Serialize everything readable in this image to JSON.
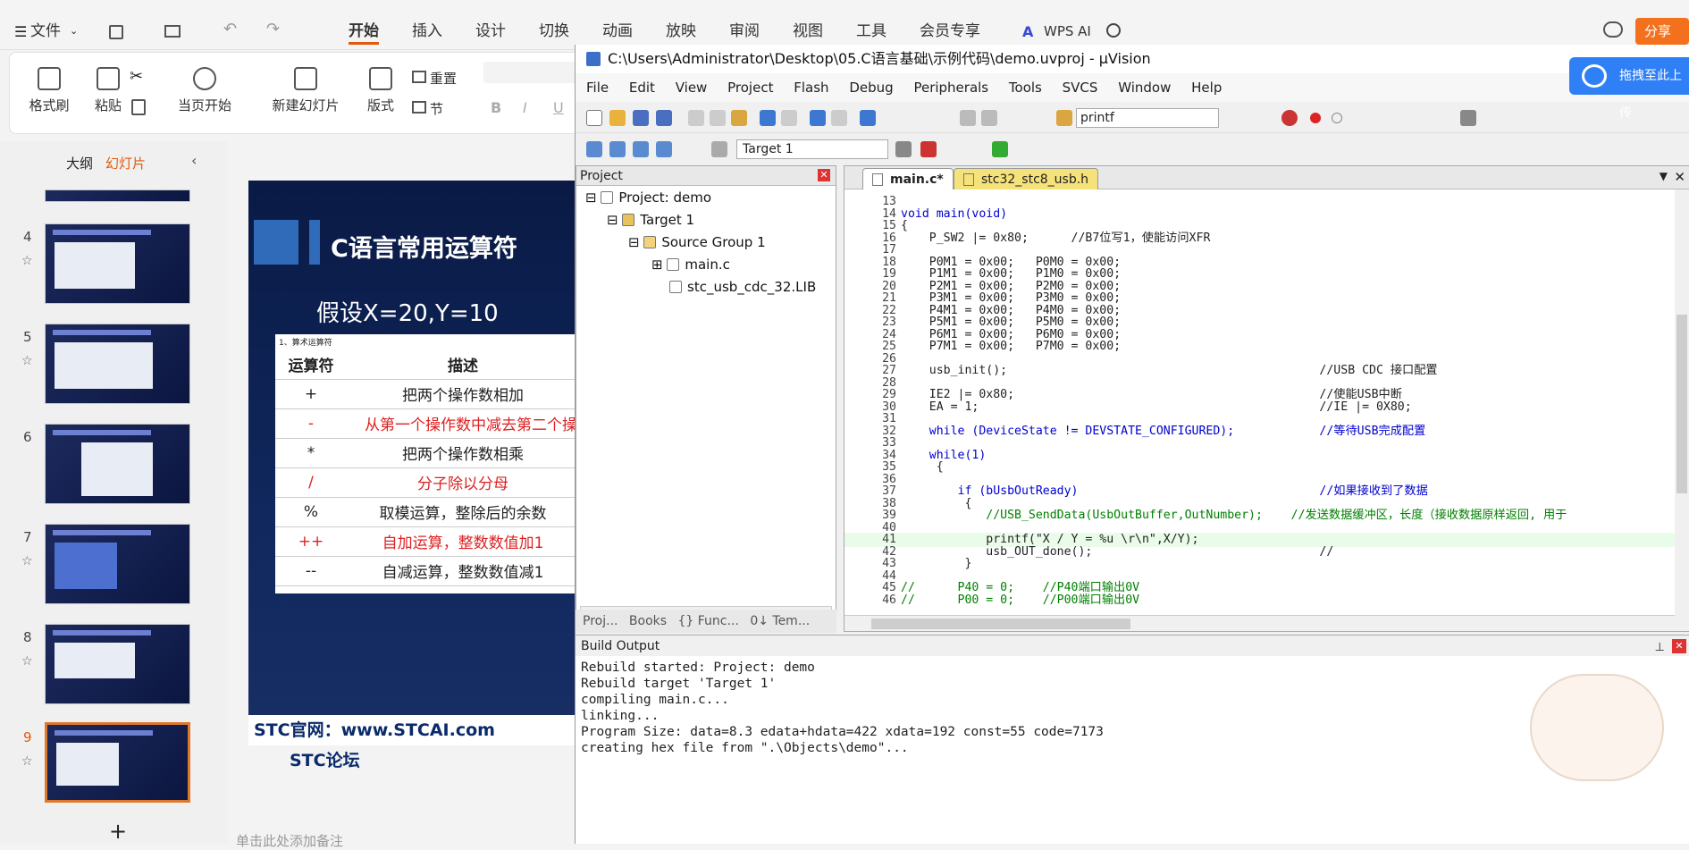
{
  "wps": {
    "file_menu": "文件",
    "tabs": [
      "开始",
      "插入",
      "设计",
      "切换",
      "动画",
      "放映",
      "审阅",
      "视图",
      "工具",
      "会员专享"
    ],
    "ai_label": "WPS AI",
    "share_label": "分享",
    "cloud_label": "拖拽至此上传"
  },
  "ribbon": {
    "format_painter": "格式刷",
    "paste": "粘贴",
    "from_current": "当页开始",
    "new_slide": "新建幻灯片",
    "layout": "版式",
    "section": "节",
    "reset": "重置"
  },
  "slide_panel": {
    "tab_outline": "大纲",
    "tab_slides": "幻灯片",
    "slide_numbers": [
      "4",
      "5",
      "6",
      "7",
      "8",
      "9"
    ],
    "add_label": "+"
  },
  "slide": {
    "title": "C语言常用运算符",
    "subtitle": "假设X=20,Y=10",
    "table_caption": "1、算术运算符",
    "col_op": "运算符",
    "col_desc": "描述",
    "rows": [
      {
        "op": "+",
        "desc": "把两个操作数相加",
        "red": false
      },
      {
        "op": "-",
        "desc": "从第一个操作数中减去第二个操",
        "red": true
      },
      {
        "op": "*",
        "desc": "把两个操作数相乘",
        "red": false
      },
      {
        "op": "/",
        "desc": "分子除以分母",
        "red": true
      },
      {
        "op": "%",
        "desc": "取模运算，整除后的余数",
        "red": false
      },
      {
        "op": "++",
        "desc": "自加运算，整数数值加1",
        "red": true
      },
      {
        "op": "--",
        "desc": "自减运算，整数数值减1",
        "red": false
      }
    ],
    "footer_left": "STC官网：www.STCAI.com",
    "footer_right": "STC论坛",
    "notes_hint": "单击此处添加备注"
  },
  "uvision": {
    "title": "C:\\Users\\Administrator\\Desktop\\05.C语言基础\\示例代码\\demo.uvproj - µVision",
    "menu": [
      "File",
      "Edit",
      "View",
      "Project",
      "Flash",
      "Debug",
      "Peripherals",
      "Tools",
      "SVCS",
      "Window",
      "Help"
    ],
    "find_value": "printf",
    "target_value": "Target 1",
    "project_header": "Project",
    "tree": {
      "root": "Project: demo",
      "target": "Target 1",
      "group": "Source Group 1",
      "file1": "main.c",
      "file2": "stc_usb_cdc_32.LIB"
    },
    "bottom_tabs": [
      "Proj...",
      "Books",
      "{} Func...",
      "0↓ Tem..."
    ],
    "editor_tabs": [
      "main.c*",
      "stc32_stc8_usb.h"
    ],
    "code": [
      {
        "n": "13",
        "t": ""
      },
      {
        "n": "14",
        "t": "void main(void)"
      },
      {
        "n": "15",
        "t": "{"
      },
      {
        "n": "16",
        "t": "    P_SW2 |= 0x80;      //B7位写1，使能访问XFR"
      },
      {
        "n": "17",
        "t": ""
      },
      {
        "n": "18",
        "t": "    P0M1 = 0x00;   P0M0 = 0x00;"
      },
      {
        "n": "19",
        "t": "    P1M1 = 0x00;   P1M0 = 0x00;"
      },
      {
        "n": "20",
        "t": "    P2M1 = 0x00;   P2M0 = 0x00;"
      },
      {
        "n": "21",
        "t": "    P3M1 = 0x00;   P3M0 = 0x00;"
      },
      {
        "n": "22",
        "t": "    P4M1 = 0x00;   P4M0 = 0x00;"
      },
      {
        "n": "23",
        "t": "    P5M1 = 0x00;   P5M0 = 0x00;"
      },
      {
        "n": "24",
        "t": "    P6M1 = 0x00;   P6M0 = 0x00;"
      },
      {
        "n": "25",
        "t": "    P7M1 = 0x00;   P7M0 = 0x00;"
      },
      {
        "n": "26",
        "t": ""
      },
      {
        "n": "27",
        "t": "    usb_init();                                            //USB CDC 接口配置"
      },
      {
        "n": "28",
        "t": ""
      },
      {
        "n": "29",
        "t": "    IE2 |= 0x80;                                           //使能USB中断"
      },
      {
        "n": "30",
        "t": "    EA = 1;                                                //IE |= 0X80;"
      },
      {
        "n": "31",
        "t": ""
      },
      {
        "n": "32",
        "t": "    while (DeviceState != DEVSTATE_CONFIGURED);            //等待USB完成配置"
      },
      {
        "n": "33",
        "t": ""
      },
      {
        "n": "34",
        "t": "    while(1)"
      },
      {
        "n": "35",
        "t": "     {"
      },
      {
        "n": "36",
        "t": ""
      },
      {
        "n": "37",
        "t": "        if (bUsbOutReady)                                  //如果接收到了数据"
      },
      {
        "n": "38",
        "t": "         {"
      },
      {
        "n": "39",
        "t": "            //USB_SendData(UsbOutBuffer,OutNumber);    //发送数据缓冲区，长度（接收数据原样返回, 用于"
      },
      {
        "n": "40",
        "t": ""
      },
      {
        "n": "41",
        "t": "            printf(\"X / Y = %u \\r\\n\",X/Y);"
      },
      {
        "n": "42",
        "t": "            usb_OUT_done();                                //"
      },
      {
        "n": "43",
        "t": "         }"
      },
      {
        "n": "44",
        "t": ""
      },
      {
        "n": "45",
        "t": "//      P40 = 0;    //P40端口输出0V"
      },
      {
        "n": "46",
        "t": "//      P00 = 0;    //P00端口输出0V"
      }
    ],
    "build_header": "Build Output",
    "build_lines": [
      "Rebuild started: Project: demo",
      "Rebuild target 'Target 1'",
      "compiling main.c...",
      "linking...",
      "Program Size: data=8.3 edata+hdata=422 xdata=192 const=55 code=7173",
      "creating hex file from \".\\Objects\\demo\"..."
    ]
  }
}
